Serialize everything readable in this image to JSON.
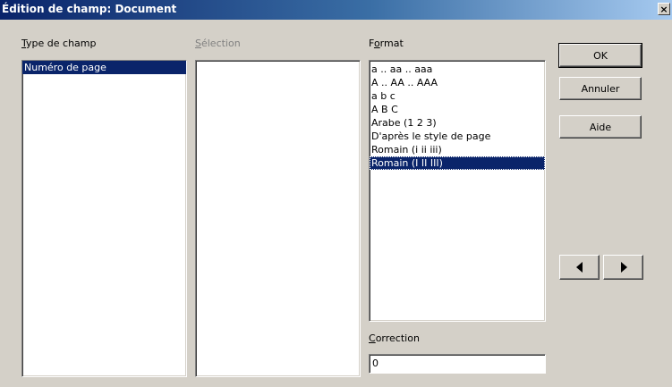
{
  "window": {
    "title": "Édition de champ: Document",
    "close_label": "×"
  },
  "type_champ": {
    "label": "Type de champ",
    "mnemonic": "T",
    "items": [
      {
        "label": "Numéro de page",
        "selected": true
      }
    ]
  },
  "selection": {
    "label": "Sélection",
    "mnemonic": "S",
    "enabled": false,
    "items": []
  },
  "format": {
    "label": "Format",
    "mnemonic": "o",
    "items": [
      {
        "label": "a .. aa .. aaa",
        "selected": false
      },
      {
        "label": "A .. AA .. AAA",
        "selected": false
      },
      {
        "label": "a b c",
        "selected": false
      },
      {
        "label": "A B C",
        "selected": false
      },
      {
        "label": "Arabe (1 2 3)",
        "selected": false
      },
      {
        "label": "D'après le style de page",
        "selected": false
      },
      {
        "label": "Romain (i ii iii)",
        "selected": false
      },
      {
        "label": "Romain (I II III)",
        "selected": true
      }
    ]
  },
  "correction": {
    "label": "Correction",
    "mnemonic": "C",
    "value": "0"
  },
  "buttons": {
    "ok": "OK",
    "cancel": "Annuler",
    "help": "Aide"
  },
  "nav": {
    "prev_icon": "left-arrow-icon",
    "next_icon": "right-arrow-icon"
  },
  "colors": {
    "dialog_bg": "#d4d0c8",
    "title_start": "#0a246a",
    "title_end": "#a6caf0",
    "selection_bg": "#0a246a"
  }
}
